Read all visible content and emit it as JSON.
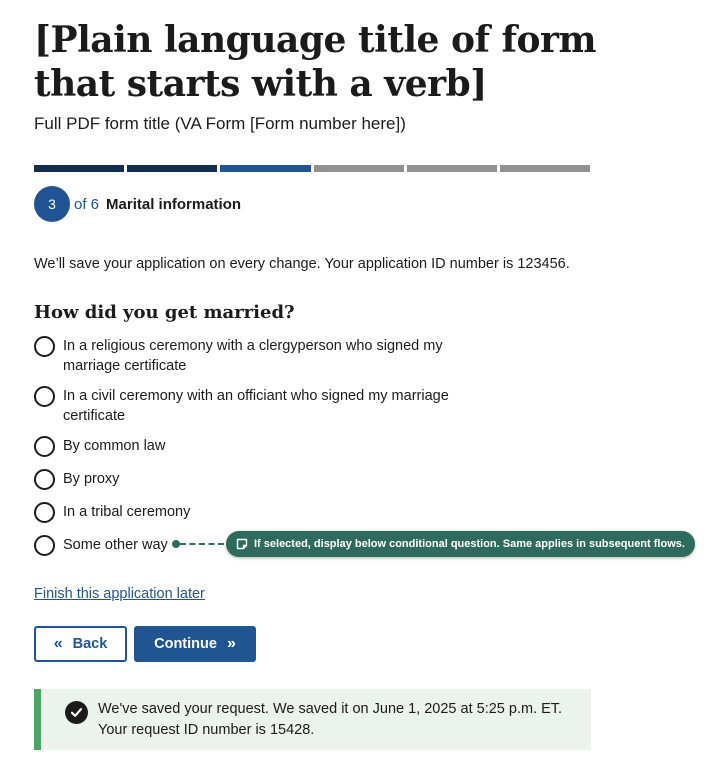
{
  "page": {
    "title": "[Plain language title of form that starts with a verb]",
    "subtitle": "Full PDF form title (VA Form [Form number here])"
  },
  "progress": {
    "current_step": "3",
    "total_label": "of 6",
    "step_name": "Marital information",
    "segments": [
      {
        "state": "complete",
        "color": "#112e51"
      },
      {
        "state": "complete",
        "color": "#112e51"
      },
      {
        "state": "current",
        "color": "#205493"
      },
      {
        "state": "incomplete",
        "color": "#919191"
      },
      {
        "state": "incomplete",
        "color": "#919191"
      },
      {
        "state": "incomplete",
        "color": "#919191"
      }
    ]
  },
  "save_note": "We’ll save your application on every change. Your application ID number is 123456.",
  "question": {
    "label": "How did you get married?",
    "options": [
      {
        "label": "In a religious ceremony with a clergyperson who signed my marriage certificate",
        "selected": false
      },
      {
        "label": "In a civil ceremony with an officiant who signed my marriage certificate",
        "selected": false
      },
      {
        "label": "By common law",
        "selected": false
      },
      {
        "label": "By proxy",
        "selected": false
      },
      {
        "label": "In a tribal ceremony",
        "selected": false
      },
      {
        "label": "Some other way",
        "selected": false
      }
    ]
  },
  "annotation": {
    "text": "If selected, display below conditional question. Same applies in subsequent flows.",
    "icon": "note-icon",
    "color": "#2e6b5e"
  },
  "finish_link": "Finish this application later",
  "buttons": {
    "back": "Back",
    "continue": "Continue"
  },
  "alert": {
    "line1": "We've saved your request. We saved it on June 1, 2025 at 5:25 p.m. ET.",
    "line2": "Your request ID number is 15428.",
    "icon": "check-circle-icon",
    "border_color": "#4aa564",
    "background": "#ecf3ec"
  },
  "colors": {
    "primary": "#205493",
    "primary_dark": "#112e51",
    "text": "#1b1b1b"
  }
}
